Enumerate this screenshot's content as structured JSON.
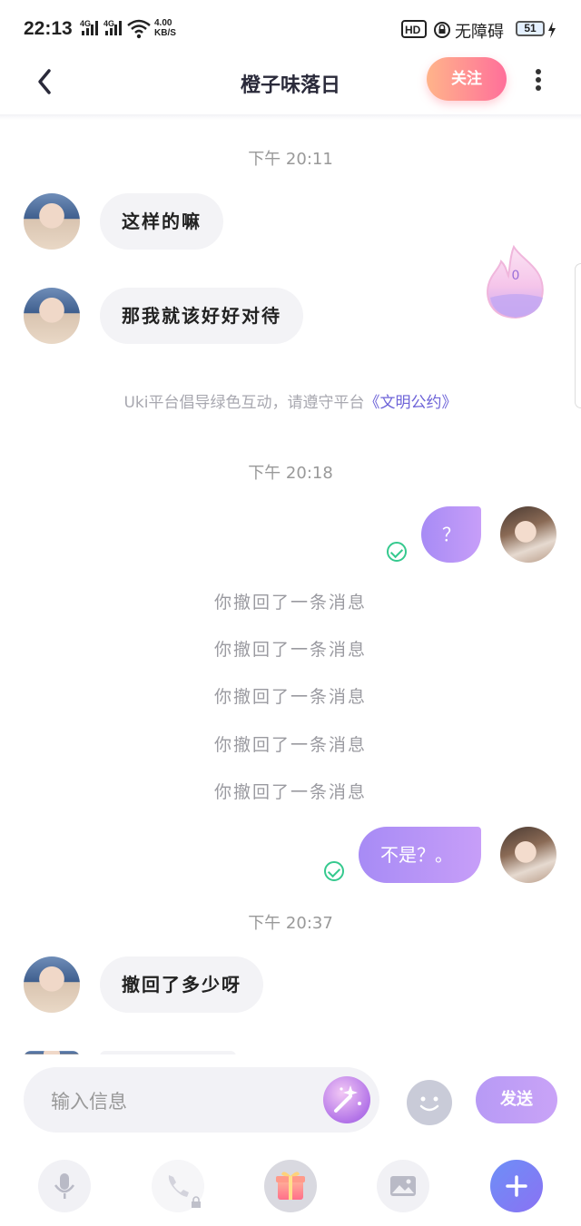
{
  "status_bar": {
    "time": "22:13",
    "net1": "4G",
    "net2": "4G",
    "speed_value": "4.00",
    "speed_unit": "KB/S",
    "hd": "HD",
    "accessibility": "无障碍",
    "battery": "51"
  },
  "header": {
    "title": "橙子味落日",
    "follow_label": "关注"
  },
  "messages": {
    "ts1": "下午 20:11",
    "m1": "这样的嘛",
    "m2": "那我就该好好对待",
    "notice_prefix": "Uki平台倡导绿色互动，请遵守平台",
    "notice_link": "《文明公约》",
    "ts2": "下午 20:18",
    "m3": "？",
    "recall": [
      "你撤回了一条消息",
      "你撤回了一条消息",
      "你撤回了一条消息",
      "你撤回了一条消息",
      "你撤回了一条消息"
    ],
    "m4": "不是？。",
    "ts3": "下午 20:37",
    "m5": "撤回了多少呀"
  },
  "flame_count": "0",
  "input": {
    "placeholder": "输入信息",
    "value": "",
    "send_label": "发送"
  },
  "toolbar_icons": [
    "microphone-icon",
    "phone-icon",
    "gift-icon",
    "image-icon",
    "plus-icon"
  ],
  "colors": {
    "accent": "#a78bf5",
    "follow": "#ff6f9a",
    "check": "#35c98e",
    "link": "#6d63d8"
  }
}
